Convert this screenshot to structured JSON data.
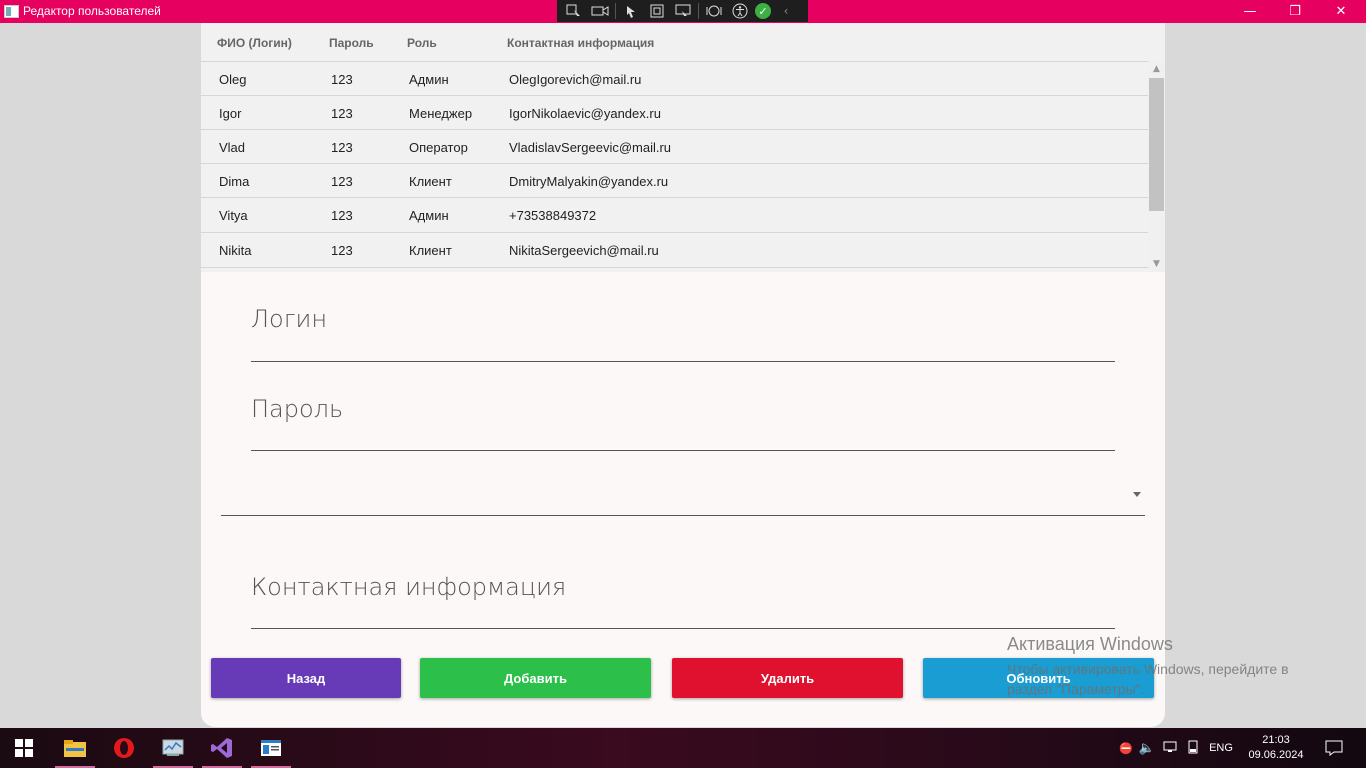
{
  "window": {
    "title": "Редактор пользователей",
    "controls": {
      "minimize": "—",
      "restore": "❐",
      "close": "✕"
    },
    "devtools": [
      "cursor-select-icon",
      "record-icon",
      "pointer-icon",
      "frame-icon",
      "layout-icon",
      "hot-reload-icon",
      "accessibility-icon",
      "check-icon",
      "collapse-icon"
    ]
  },
  "grid": {
    "columns": [
      "ФИО (Логин)",
      "Пароль",
      "Роль",
      "Контактная информация"
    ],
    "rows": [
      {
        "login": "Oleg",
        "password": "123",
        "role": "Админ",
        "contact": "OlegIgorevich@mail.ru"
      },
      {
        "login": "Igor",
        "password": "123",
        "role": "Менеджер",
        "contact": "IgorNikolaevic@yandex.ru"
      },
      {
        "login": "Vlad",
        "password": "123",
        "role": "Оператор",
        "contact": "VladislavSergeevic@mail.ru"
      },
      {
        "login": "Dima",
        "password": "123",
        "role": "Клиент",
        "contact": "DmitryMalyakin@yandex.ru"
      },
      {
        "login": "Vitya",
        "password": "123",
        "role": "Админ",
        "contact": "+73538849372"
      },
      {
        "login": "Nikita",
        "password": "123",
        "role": "Клиент",
        "contact": "NikitaSergeevich@mail.ru"
      }
    ]
  },
  "form": {
    "login_label": "Логин",
    "password_label": "Пароль",
    "role_value": "",
    "contact_label": "Контактная информация"
  },
  "buttons": {
    "back": "Назад",
    "add": "Добавить",
    "delete": "Удалить",
    "refresh": "Обновить"
  },
  "colors": {
    "titlebar": "#e6005f",
    "back": "#673ab7",
    "add": "#2cc04a",
    "delete": "#e0112e",
    "refresh": "#1a9dd2"
  },
  "watermark": {
    "line1": "Активация Windows",
    "line2": "Чтобы активировать Windows, перейдите в",
    "line3": "раздел \"Параметры\"."
  },
  "taskbar": {
    "apps": [
      "windows-start-icon",
      "file-explorer-icon",
      "opera-icon",
      "task-manager-icon",
      "visual-studio-icon",
      "app-window-icon"
    ],
    "language": "ENG",
    "time": "21:03",
    "date": "09.06.2024"
  }
}
